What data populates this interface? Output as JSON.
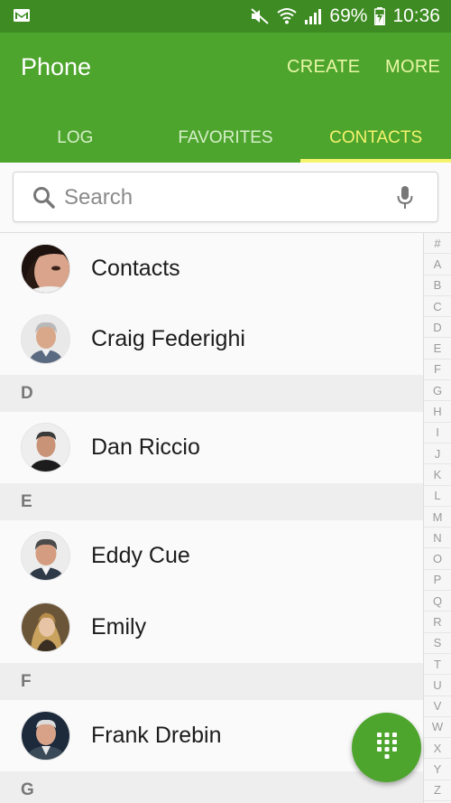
{
  "status_bar": {
    "battery": "69%",
    "time": "10:36",
    "icons": [
      "gmail-icon",
      "mute-icon",
      "wifi-icon",
      "signal-icon",
      "battery-charging-icon"
    ]
  },
  "app_bar": {
    "title": "Phone",
    "actions": {
      "create": "CREATE",
      "more": "MORE"
    }
  },
  "tabs": [
    {
      "label": "LOG",
      "active": false
    },
    {
      "label": "FAVORITES",
      "active": false
    },
    {
      "label": "CONTACTS",
      "active": true
    }
  ],
  "search": {
    "placeholder": "Search",
    "value": ""
  },
  "contacts": [
    {
      "type": "contact",
      "name": "Contacts",
      "avatar": "avatar-photo"
    },
    {
      "type": "contact",
      "name": "Craig Federighi",
      "avatar": "avatar-photo"
    },
    {
      "type": "header",
      "letter": "D"
    },
    {
      "type": "contact",
      "name": "Dan Riccio",
      "avatar": "avatar-photo"
    },
    {
      "type": "header",
      "letter": "E"
    },
    {
      "type": "contact",
      "name": "Eddy Cue",
      "avatar": "avatar-photo"
    },
    {
      "type": "contact",
      "name": "Emily",
      "avatar": "avatar-photo"
    },
    {
      "type": "header",
      "letter": "F"
    },
    {
      "type": "contact",
      "name": "Frank Drebin",
      "avatar": "avatar-photo"
    },
    {
      "type": "header",
      "letter": "G"
    }
  ],
  "index_letters": [
    "#",
    "A",
    "B",
    "C",
    "D",
    "E",
    "F",
    "G",
    "H",
    "I",
    "J",
    "K",
    "L",
    "M",
    "N",
    "O",
    "P",
    "Q",
    "R",
    "S",
    "T",
    "U",
    "V",
    "W",
    "X",
    "Y",
    "Z"
  ],
  "fab": {
    "icon": "dialpad-icon"
  },
  "colors": {
    "status_bar": "#3d8b22",
    "app_bar": "#4ea52d",
    "action_text": "#e9f7a6",
    "active_tab": "#f5f36e",
    "section_header_bg": "#eeeeee"
  }
}
